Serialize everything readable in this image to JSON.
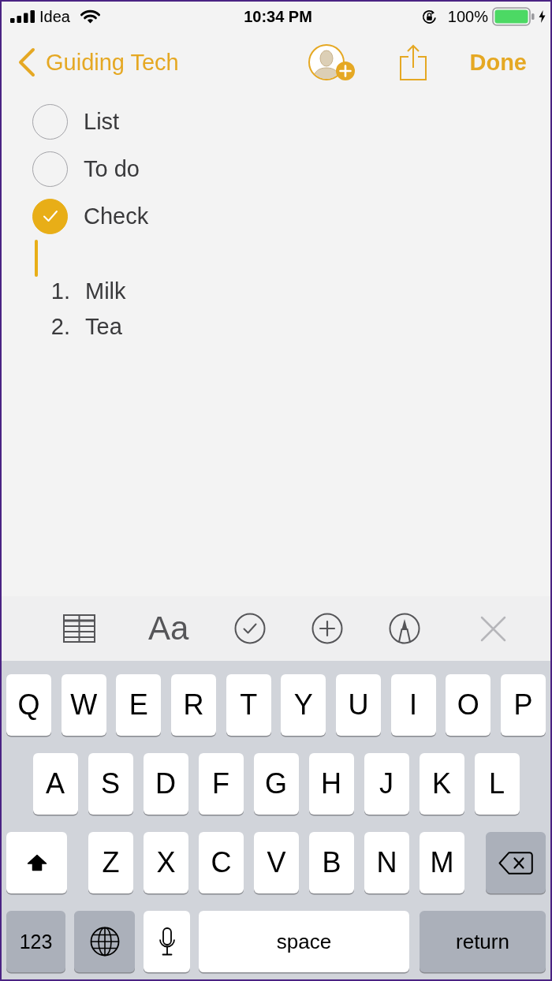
{
  "status_bar": {
    "carrier": "Idea",
    "time": "10:34 PM",
    "battery_percent": "100%"
  },
  "nav_bar": {
    "back_label": "Guiding Tech",
    "done_label": "Done"
  },
  "note": {
    "checklist": [
      {
        "text": "List",
        "checked": false
      },
      {
        "text": "To do",
        "checked": false
      },
      {
        "text": "Check",
        "checked": true
      }
    ],
    "numbered_list": [
      {
        "number": "1.",
        "text": "Milk"
      },
      {
        "number": "2.",
        "text": "Tea"
      }
    ]
  },
  "format_bar": {
    "text_style_label": "Aa"
  },
  "keyboard": {
    "key_rows": [
      {
        "keys": [
          {
            "kind": "letter",
            "label": "Q"
          },
          {
            "kind": "letter",
            "label": "W"
          },
          {
            "kind": "letter",
            "label": "E"
          },
          {
            "kind": "letter",
            "label": "R"
          },
          {
            "kind": "letter",
            "label": "T"
          },
          {
            "kind": "letter",
            "label": "Y"
          },
          {
            "kind": "letter",
            "label": "U"
          },
          {
            "kind": "letter",
            "label": "I"
          },
          {
            "kind": "letter",
            "label": "O"
          },
          {
            "kind": "letter",
            "label": "P"
          }
        ]
      },
      {
        "keys": [
          {
            "kind": "letter",
            "label": "A"
          },
          {
            "kind": "letter",
            "label": "S"
          },
          {
            "kind": "letter",
            "label": "D"
          },
          {
            "kind": "letter",
            "label": "F"
          },
          {
            "kind": "letter",
            "label": "G"
          },
          {
            "kind": "letter",
            "label": "H"
          },
          {
            "kind": "letter",
            "label": "J"
          },
          {
            "kind": "letter",
            "label": "K"
          },
          {
            "kind": "letter",
            "label": "L"
          }
        ]
      },
      {
        "keys": [
          {
            "kind": "shift"
          },
          {
            "kind": "letter",
            "label": "Z"
          },
          {
            "kind": "letter",
            "label": "X"
          },
          {
            "kind": "letter",
            "label": "C"
          },
          {
            "kind": "letter",
            "label": "V"
          },
          {
            "kind": "letter",
            "label": "B"
          },
          {
            "kind": "letter",
            "label": "N"
          },
          {
            "kind": "letter",
            "label": "M"
          },
          {
            "kind": "delete"
          }
        ]
      },
      {
        "keys": [
          {
            "kind": "mode",
            "label": "123"
          },
          {
            "kind": "globe"
          },
          {
            "kind": "mic"
          },
          {
            "kind": "space",
            "label": "space"
          },
          {
            "kind": "return",
            "label": "return"
          }
        ]
      }
    ]
  }
}
